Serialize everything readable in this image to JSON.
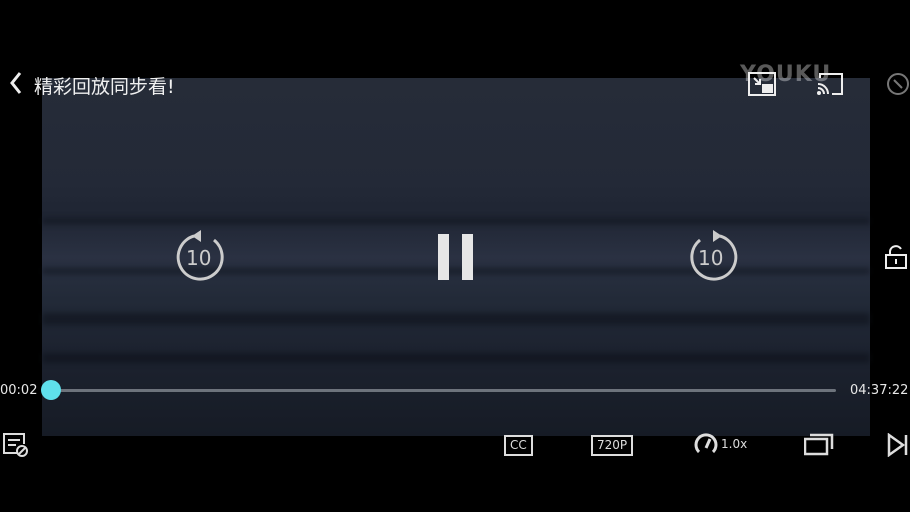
{
  "header": {
    "title": "精彩回放同步看!",
    "logo_text": "YOUKU"
  },
  "controls": {
    "rewind_seconds": "10",
    "forward_seconds": "10",
    "state": "paused-button-shown",
    "current_time": "00:02",
    "total_time": "04:37:22",
    "progress_percent": 0.01,
    "cc_label": "CC",
    "quality_label": "720P",
    "speed_label": "1.0x"
  },
  "colors": {
    "accent": "#5fe0ec",
    "background": "#000000"
  }
}
